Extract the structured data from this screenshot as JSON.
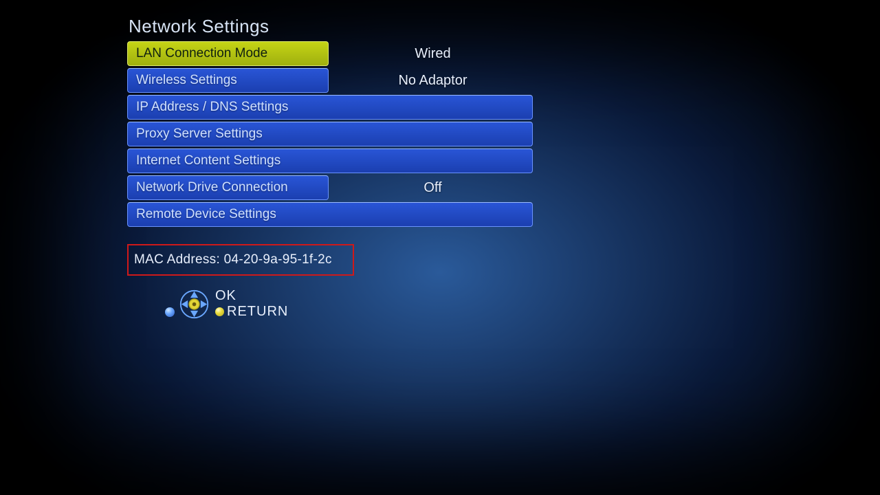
{
  "title": "Network Settings",
  "rows": [
    {
      "label": "LAN Connection Mode",
      "value": "Wired",
      "highlight": true,
      "half": true
    },
    {
      "label": "Wireless Settings",
      "value": "No Adaptor",
      "highlight": false,
      "half": true
    },
    {
      "label": "IP Address / DNS Settings",
      "value": null,
      "highlight": false,
      "half": false
    },
    {
      "label": "Proxy Server Settings",
      "value": null,
      "highlight": false,
      "half": false
    },
    {
      "label": "Internet Content Settings",
      "value": null,
      "highlight": false,
      "half": false
    },
    {
      "label": "Network Drive Connection",
      "value": "Off",
      "highlight": false,
      "half": true
    },
    {
      "label": "Remote Device Settings",
      "value": null,
      "highlight": false,
      "half": false
    }
  ],
  "mac_label": "MAC Address: ",
  "mac_value": "04-20-9a-95-1f-2c",
  "legend": {
    "ok": "OK",
    "return": "RETURN"
  }
}
